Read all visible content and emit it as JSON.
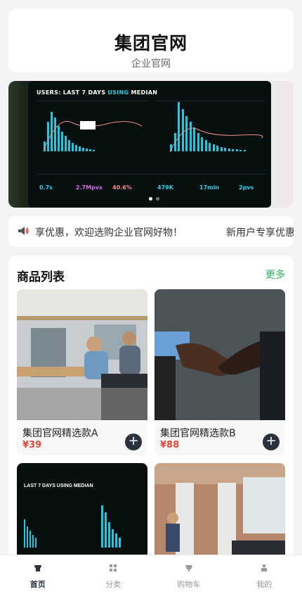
{
  "header": {
    "title": "集团官网",
    "subtitle": "企业官网"
  },
  "banner": {
    "screen_title_a": "USERS: LAST 7 DAYS ",
    "screen_title_b": "USING",
    "screen_title_c": " MEDIAN",
    "stats": [
      "0.7s",
      "2.7Mpvs",
      "40.6%",
      "479K",
      "17min",
      "2pvs"
    ],
    "active_slide": 0,
    "slide_count": 2
  },
  "notice": {
    "icon": "speaker-icon",
    "text_1": "享优惠，欢迎选购企业官网好物！",
    "text_2": "新用户专享优惠"
  },
  "products": {
    "title": "商品列表",
    "more_label": "更多",
    "items": [
      {
        "name": "集团官网精选款A",
        "price": "¥39",
        "image": "office-team-photo"
      },
      {
        "name": "集团官网精选款B",
        "price": "¥88",
        "image": "handshake-photo"
      },
      {
        "name": "",
        "price": "",
        "image": "analytics-screen-photo"
      },
      {
        "name": "",
        "price": "",
        "image": "presentation-photo"
      }
    ],
    "add_label": "+"
  },
  "tabbar": {
    "tabs": [
      {
        "label": "首页",
        "icon": "home-icon",
        "active": true
      },
      {
        "label": "分类",
        "icon": "grid-icon",
        "active": false
      },
      {
        "label": "购物车",
        "icon": "cart-icon",
        "active": false
      },
      {
        "label": "我的",
        "icon": "user-icon",
        "active": false
      }
    ]
  }
}
